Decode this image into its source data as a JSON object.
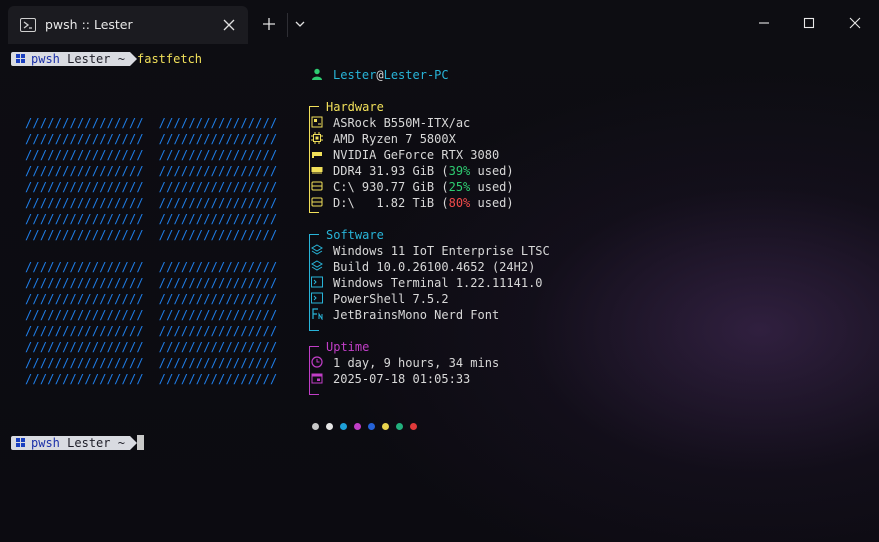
{
  "titlebar": {
    "tab_title": "pwsh :: Lester"
  },
  "prompt": {
    "shell": "pwsh",
    "user": "Lester",
    "dir": "~"
  },
  "command": "fastfetch",
  "logo_line": "////////////////  ////////////////",
  "header": {
    "user": "Lester",
    "at": "@",
    "host": "Lester-PC"
  },
  "hardware": {
    "title": "Hardware",
    "board": "ASRock B550M-ITX/ac",
    "cpu": "AMD Ryzen 7 5800X",
    "gpu": "NVIDIA GeForce RTX 3080",
    "memory_prefix": "DDR4 31.93 GiB (",
    "memory_pct": "39%",
    "memory_suffix": " used)",
    "disk_c_prefix": "C:\\ 930.77 GiB (",
    "disk_c_pct": "25%",
    "disk_c_suffix": " used)",
    "disk_d_prefix": "D:\\   1.82 TiB (",
    "disk_d_pct": "80%",
    "disk_d_suffix": " used)"
  },
  "software": {
    "title": "Software",
    "os": "Windows 11 IoT Enterprise LTSC",
    "build": "Build 10.0.26100.4652 (24H2)",
    "terminal": "Windows Terminal 1.22.11141.0",
    "shell": "PowerShell 7.5.2",
    "font": "JetBrainsMono Nerd Font"
  },
  "uptime": {
    "title": "Uptime",
    "duration": "1 day, 9 hours, 34 mins",
    "datetime": "2025-07-18 01:05:33"
  },
  "colors": {
    "hardware_accent": "#f1e05a",
    "software_accent": "#28b4d8",
    "uptime_accent": "#c13ec7",
    "logo": "#1f7ee8",
    "ok": "#2ecc71",
    "warn": "#f24b4b",
    "palette": [
      "#c8c8c8",
      "#e6e6e6",
      "#1ea0d8",
      "#c13ec7",
      "#2563d8",
      "#e8d44d",
      "#22b07d",
      "#e03a3a"
    ]
  }
}
